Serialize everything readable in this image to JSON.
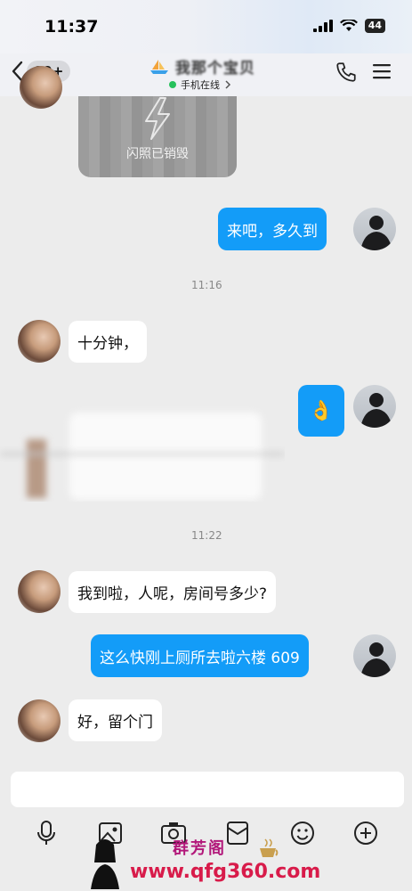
{
  "status_bar": {
    "time": "11:37",
    "battery": "44"
  },
  "header": {
    "unread_count": "99+",
    "title": "我那个宝贝",
    "status": "手机在线",
    "status_color": "#27c15c"
  },
  "messages": {
    "flash_text": "闪照已销毁",
    "m1": "来吧，多久到",
    "ts1": "11:16",
    "m2": "十分钟，",
    "m3": "👌",
    "ts2": "11:22",
    "m4": "我到啦，人呢，房间号多少?",
    "m5": "这么快刚上厕所去啦六楼 609",
    "m6": "好，留个门"
  },
  "colors": {
    "outgoing_bubble": "#139cf8",
    "incoming_bubble": "#ffffff",
    "background": "#ececec"
  },
  "icons": [
    "back-arrow-icon",
    "phone-icon",
    "menu-icon",
    "mic-icon",
    "image-icon",
    "camera-icon",
    "red-packet-icon",
    "emoji-icon",
    "plus-icon"
  ],
  "watermark": {
    "name": "群芳阁",
    "url": "www.qfg360.com"
  }
}
